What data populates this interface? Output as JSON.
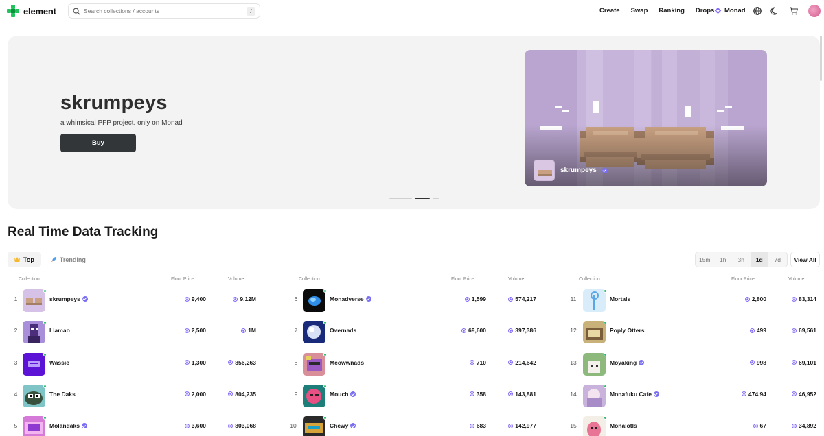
{
  "brand": {
    "name": "element"
  },
  "search": {
    "placeholder": "Search collections / accounts",
    "shortcut": "/"
  },
  "nav": {
    "links": [
      "Create",
      "Swap",
      "Ranking",
      "Drops"
    ],
    "chain": "Monad"
  },
  "hero": {
    "title": "skrumpeys",
    "subtitle": "a whimsical PFP project. only on Monad",
    "buy_label": "Buy",
    "collection_name": "skrumpeys"
  },
  "section": {
    "title": "Real Time Data Tracking"
  },
  "tabs": [
    {
      "label": "Top",
      "active": true
    },
    {
      "label": "Trending",
      "active": false
    }
  ],
  "time_filters": [
    {
      "label": "15m",
      "active": false
    },
    {
      "label": "1h",
      "active": false
    },
    {
      "label": "3h",
      "active": false
    },
    {
      "label": "1d",
      "active": true
    },
    {
      "label": "7d",
      "active": false
    }
  ],
  "view_all_label": "View All",
  "table_headers": {
    "collection": "Collection",
    "floor": "Floor Price",
    "volume": "Volume"
  },
  "rankings": [
    {
      "rank": "1",
      "name": "skrumpeys",
      "verified": true,
      "floor": "9,400",
      "volume": "9.12M",
      "thumb": "skrumpeys"
    },
    {
      "rank": "2",
      "name": "Llamao",
      "verified": false,
      "floor": "2,500",
      "volume": "1M",
      "thumb": "llamao"
    },
    {
      "rank": "3",
      "name": "Wassie",
      "verified": false,
      "floor": "1,300",
      "volume": "856,263",
      "thumb": "wassie"
    },
    {
      "rank": "4",
      "name": "The Daks",
      "verified": false,
      "floor": "2,000",
      "volume": "804,235",
      "thumb": "daks"
    },
    {
      "rank": "5",
      "name": "Molandaks",
      "verified": true,
      "floor": "3,600",
      "volume": "803,068",
      "thumb": "molandaks"
    },
    {
      "rank": "6",
      "name": "Monadverse",
      "verified": true,
      "floor": "1,599",
      "volume": "574,217",
      "thumb": "monadverse"
    },
    {
      "rank": "7",
      "name": "Overnads",
      "verified": false,
      "floor": "69,600",
      "volume": "397,386",
      "thumb": "overnads"
    },
    {
      "rank": "8",
      "name": "Meowwnads",
      "verified": false,
      "floor": "710",
      "volume": "214,642",
      "thumb": "meowwnads"
    },
    {
      "rank": "9",
      "name": "Mouch",
      "verified": true,
      "floor": "358",
      "volume": "143,881",
      "thumb": "mouch"
    },
    {
      "rank": "10",
      "name": "Chewy",
      "verified": true,
      "floor": "683",
      "volume": "142,977",
      "thumb": "chewy"
    },
    {
      "rank": "11",
      "name": "Mortals",
      "verified": false,
      "floor": "2,800",
      "volume": "83,314",
      "thumb": "mortals"
    },
    {
      "rank": "12",
      "name": "Poply Otters",
      "verified": false,
      "floor": "499",
      "volume": "69,561",
      "thumb": "otters"
    },
    {
      "rank": "13",
      "name": "Moyaking",
      "verified": true,
      "floor": "998",
      "volume": "69,101",
      "thumb": "moyaking"
    },
    {
      "rank": "14",
      "name": "Monafuku Cafe",
      "verified": true,
      "floor": "474.94",
      "volume": "46,952",
      "thumb": "monafuku"
    },
    {
      "rank": "15",
      "name": "Monalotls",
      "verified": false,
      "floor": "67",
      "volume": "34,892",
      "thumb": "monalotls"
    }
  ],
  "colors": {
    "accent": "#836ef9",
    "live": "#2fbf71",
    "buy_button": "#333639",
    "hero_bg": "#f3f3f3"
  },
  "icons": [
    "search-icon",
    "globe-icon",
    "moon-icon",
    "cart-icon",
    "crown-icon",
    "rocket-icon",
    "verified-icon",
    "monad-icon"
  ]
}
